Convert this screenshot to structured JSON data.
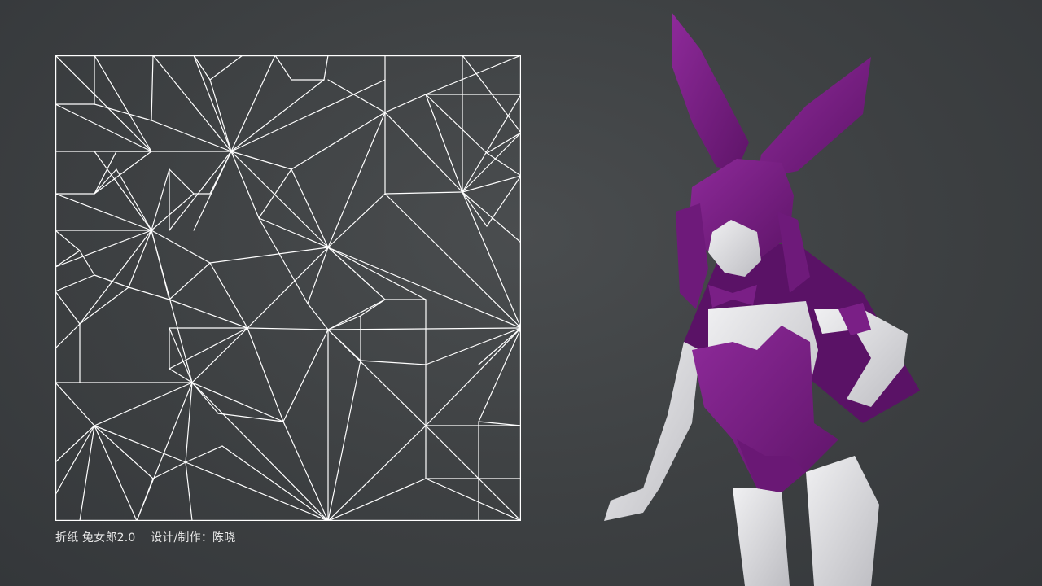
{
  "caption": {
    "text": "折纸 兔女郎2.0    设计/制作：陈晓"
  },
  "crease_pattern": {
    "icon": "crease-pattern-diagram",
    "line_color": "#ffffff"
  },
  "figure": {
    "icon": "origami-bunny-girl",
    "paper_colors": {
      "purple": "#7a1f86",
      "white": "#e3e3e5"
    }
  }
}
